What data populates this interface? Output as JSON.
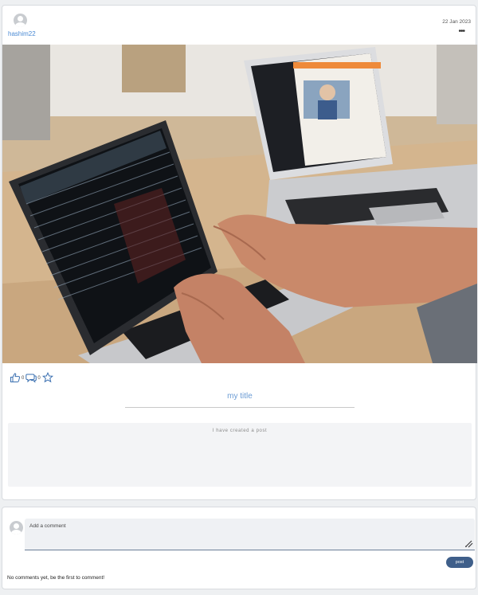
{
  "post": {
    "username": "hashim22",
    "date": "22 Jan 2023",
    "more_icon": "ellipsis-icon",
    "image_alt": "laptops-on-desk-photo",
    "likes_count": "0",
    "comments_count": "0",
    "title": "my title",
    "body": "I have created a post"
  },
  "icons": {
    "like": "thumbs-up-icon",
    "comment": "comment-bubble-icon",
    "favorite": "star-icon"
  },
  "comments": {
    "placeholder": "Add a comment",
    "post_label": "post",
    "empty_message": "No comments yet, be the first to comment!"
  },
  "colors": {
    "accent": "#4a8ad4",
    "button": "#3f5f8a"
  }
}
